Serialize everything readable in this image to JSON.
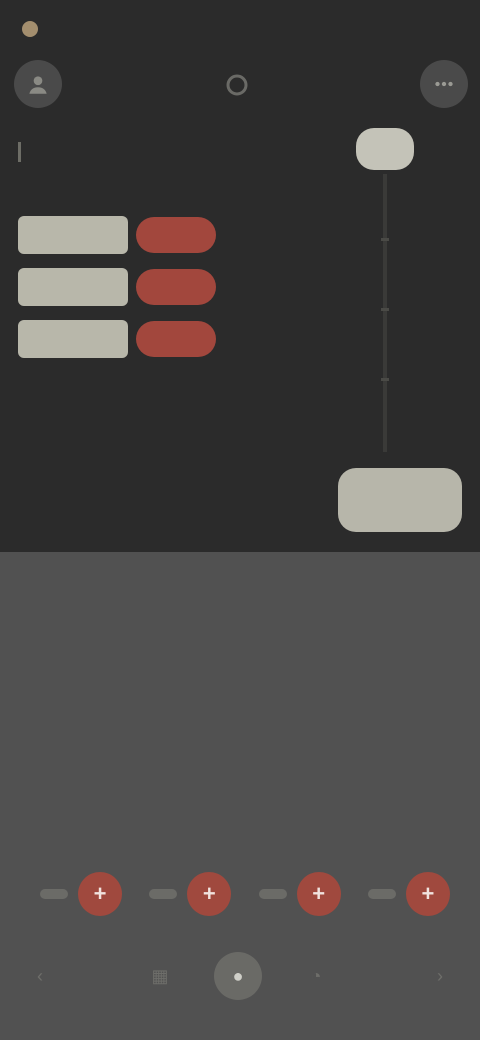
{
  "status": {
    "time": ""
  },
  "header": {
    "title": ""
  },
  "chips": [
    {
      "light": "",
      "red": ""
    },
    {
      "light": "",
      "red": ""
    },
    {
      "light": "",
      "red": ""
    }
  ],
  "chips_caption": "",
  "slider": {
    "top_value": ""
  },
  "cta": {
    "label": ""
  },
  "sheet": {
    "title": "",
    "columns": [
      {
        "label": "",
        "value": ""
      },
      {
        "label": "",
        "value": ""
      },
      {
        "label": "",
        "value": ""
      },
      {
        "label": "",
        "value": ""
      }
    ]
  },
  "steppers": [
    {
      "plus_label": "+"
    },
    {
      "plus_label": "+"
    },
    {
      "plus_label": "+"
    },
    {
      "plus_label": "+"
    }
  ],
  "nav": [
    {
      "icon": "back-icon",
      "glyph": "‹"
    },
    {
      "icon": "grid-icon",
      "glyph": "▦"
    },
    {
      "icon": "home-icon",
      "glyph": "●"
    },
    {
      "icon": "chart-icon",
      "glyph": "◔"
    },
    {
      "icon": "forward-icon",
      "glyph": "›"
    }
  ],
  "colors": {
    "accent": "#a2473d",
    "chip": "#b8b7aa",
    "background": "#2b2b2b",
    "sheet": "#515151"
  }
}
